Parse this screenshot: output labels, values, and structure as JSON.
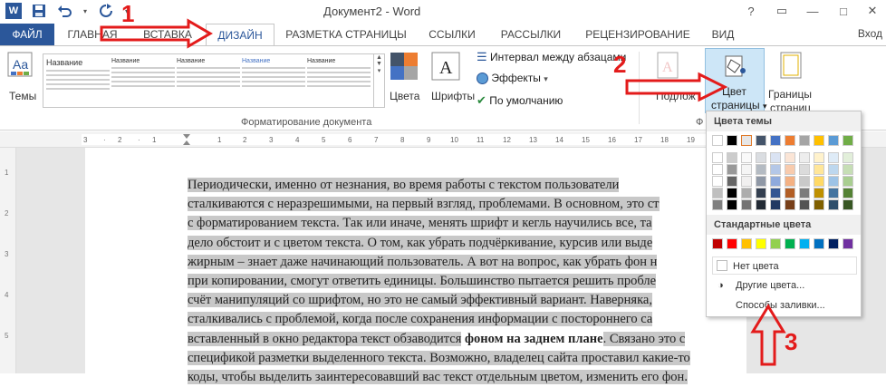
{
  "window": {
    "title": "Документ2 - Word",
    "controls": [
      "?",
      "▭",
      "—",
      "□",
      "✕"
    ]
  },
  "tabs": {
    "file": "ФАЙЛ",
    "home": "ГЛАВНАЯ",
    "insert": "ВСТАВКА",
    "design": "ДИЗАЙН",
    "layout": "РАЗМЕТКА СТРАНИЦЫ",
    "refs": "ССЫЛКИ",
    "mailings": "РАССЫЛКИ",
    "review": "РЕЦЕНЗИРОВАНИЕ",
    "view": "ВИД",
    "signin": "Вход"
  },
  "ribbon": {
    "themes": "Темы",
    "gallery_titles": [
      "Название",
      "Название",
      "Название",
      "Название",
      "Название",
      "Название"
    ],
    "colors": "Цвета",
    "fonts": "Шрифты",
    "para_spacing": "Интервал между абзацами",
    "effects": "Эффекты",
    "default": "По умолчанию",
    "group_format": "Форматирование документа",
    "watermark": "Подлож",
    "page_color_1": "Цвет",
    "page_color_2": "страницы",
    "page_borders_1": "Границы",
    "page_borders_2": "страниц",
    "group_bg": "Ф"
  },
  "dropdown": {
    "theme_colors": "Цвета темы",
    "standard_colors": "Стандартные цвета",
    "no_color": "Нет цвета",
    "more_colors": "Другие цвета...",
    "fill_effects": "Способы заливки...",
    "theme_top": [
      "#ffffff",
      "#000000",
      "#e7e6e6",
      "#44546a",
      "#4472c4",
      "#ed7d31",
      "#a5a5a5",
      "#ffc000",
      "#5b9bd5",
      "#70ad47"
    ],
    "standard": [
      "#c00000",
      "#ff0000",
      "#ffc000",
      "#ffff00",
      "#92d050",
      "#00b050",
      "#00b0f0",
      "#0070c0",
      "#002060",
      "#7030a0"
    ]
  },
  "document": {
    "lines": [
      "Периодически, именно от незнания, во время работы с текстом пользователи",
      "сталкиваются с неразрешимыми, на первый взгляд, проблемами. В основном, это ст",
      "с форматированием текста. Так или иначе, менять шрифт и кегль научились все, та",
      "дело обстоит и с цветом текста. О том, как убрать подчёркивание, курсив или выде",
      "жирным – знает даже начинающий пользователь. А вот на вопрос, как убрать фон н",
      "при копировании, смогут ответить единицы. Большинство пытается решить пробле",
      "счёт манипуляций со шрифтом, но это не самый эффективный вариант. Наверняка,",
      "сталкивались с проблемой, когда после сохранения информации с постороннего са",
      "вставленный в окно редактора текст обзаводится",
      "спецификой разметки выделенного текста. Возможно, владелец сайта проставил какие-то",
      "коды, чтобы выделить заинтересовавший вас текст отдельным цветом, изменить его фон."
    ],
    "bold_phrase": "фоном на заднем плане",
    "line9_tail": ". Связано это с"
  },
  "annotations": {
    "n1": "1",
    "n2": "2",
    "n3": "3"
  }
}
